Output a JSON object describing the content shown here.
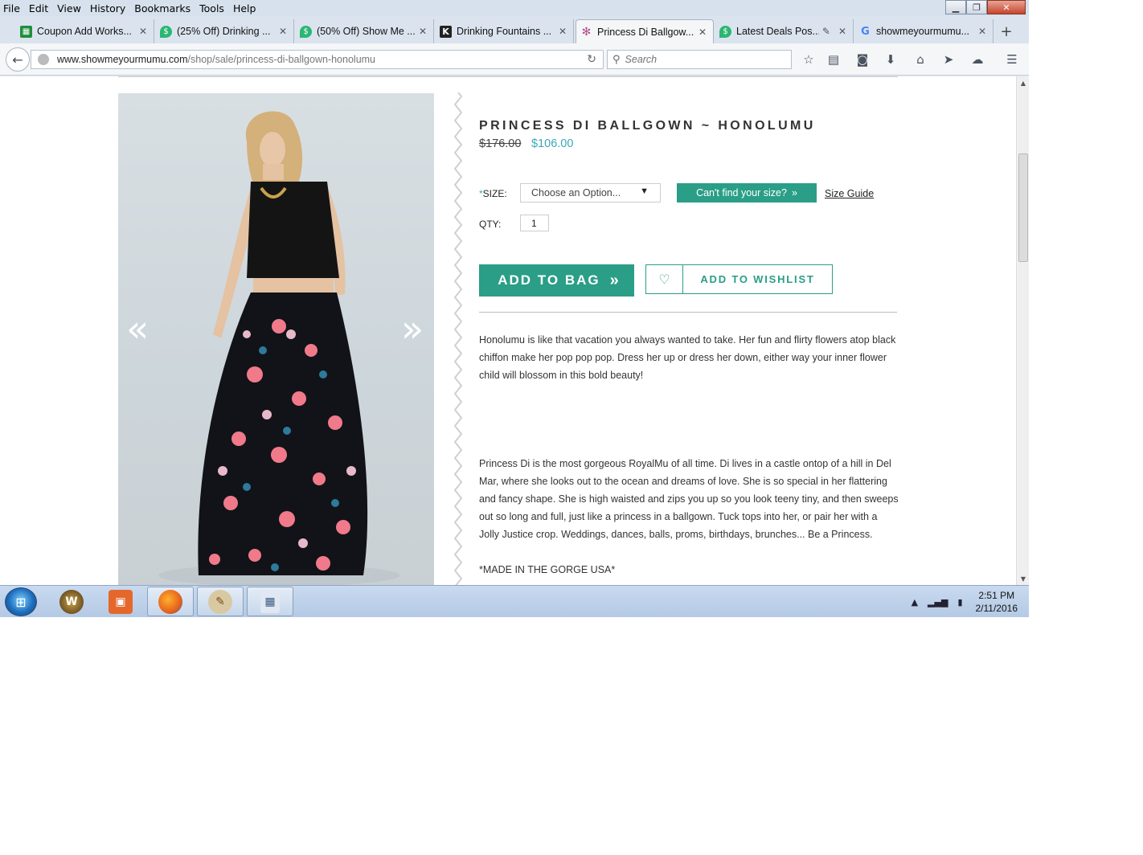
{
  "menubar": {
    "items": [
      {
        "label": "File"
      },
      {
        "label": "Edit"
      },
      {
        "label": "View"
      },
      {
        "label": "History"
      },
      {
        "label": "Bookmarks"
      },
      {
        "label": "Tools"
      },
      {
        "label": "Help"
      }
    ]
  },
  "tabs": [
    {
      "label": "Coupon Add Works...",
      "icon": "sheets-icon",
      "color": "#1e8e3e",
      "active": false
    },
    {
      "label": "(25% Off) Drinking ...",
      "icon": "tag-icon",
      "color": "#2bb673",
      "active": false
    },
    {
      "label": "(50% Off) Show Me ...",
      "icon": "tag-icon",
      "color": "#2bb673",
      "active": false
    },
    {
      "label": "Drinking Fountains ...",
      "icon": "k-icon",
      "color": "#222222",
      "active": false
    },
    {
      "label": "Princess Di Ballgow...",
      "icon": "flower-icon",
      "color": "#b94d8c",
      "active": true
    },
    {
      "label": "Latest Deals Pos...",
      "icon": "tag-icon",
      "color": "#2bb673",
      "active": false
    },
    {
      "label": "showmeyourmumu...",
      "icon": "google-icon",
      "color": "#4285f4",
      "active": false
    }
  ],
  "navbar": {
    "url_domain": "www.showmeyourmumu.com",
    "url_path": "/shop/sale/princess-di-ballgown-honolumu",
    "search_placeholder": "Search"
  },
  "product": {
    "title": "PRINCESS DI BALLGOWN ~ HONOLUMU",
    "price_old": "$176.00",
    "price_new": "$106.00",
    "size_label": "SIZE:",
    "size_required_mark": "*",
    "size_selected": "Choose an Option...",
    "cant_find_label": "Can't find your size?",
    "size_guide_label": "Size Guide",
    "qty_label": "QTY:",
    "qty_value": "1",
    "add_to_bag_label": "ADD TO BAG",
    "add_to_wishlist_label": "ADD TO WISHLIST",
    "description_1": "Honolumu is like that vacation you always wanted to take. Her fun and flirty flowers atop black chiffon make her pop pop pop. Dress her up or dress her down, either way your inner flower child will blossom in this bold beauty!",
    "description_2": "Princess Di is the most gorgeous RoyalMu of all time. Di lives in a castle ontop of a hill in Del Mar, where she looks out to the ocean and dreams of love. She is so special in her flattering and fancy shape. She is high waisted and zips you up so you look teeny tiny, and then sweeps out so long and full, just like a princess in a ballgown. Tuck tops into her, or pair her with a Jolly Justice crop. Weddings, dances, balls, proms, birthdays, brunches... Be a Princess.",
    "made_in": "*MADE IN THE GORGE USA*"
  },
  "colors": {
    "accent": "#2a9e86",
    "sale_price": "#3aa6b9"
  },
  "taskbar": {
    "apps": [
      {
        "name": "wow-icon",
        "color": "#6b4a1f"
      },
      {
        "name": "office-icon",
        "color": "#e5672c"
      },
      {
        "name": "firefox-icon",
        "color": "#e6631b"
      },
      {
        "name": "paint-icon",
        "color": "#7a9bc2"
      },
      {
        "name": "calculator-icon",
        "color": "#5b7fa6"
      }
    ],
    "time": "2:51 PM",
    "date": "2/11/2016"
  }
}
